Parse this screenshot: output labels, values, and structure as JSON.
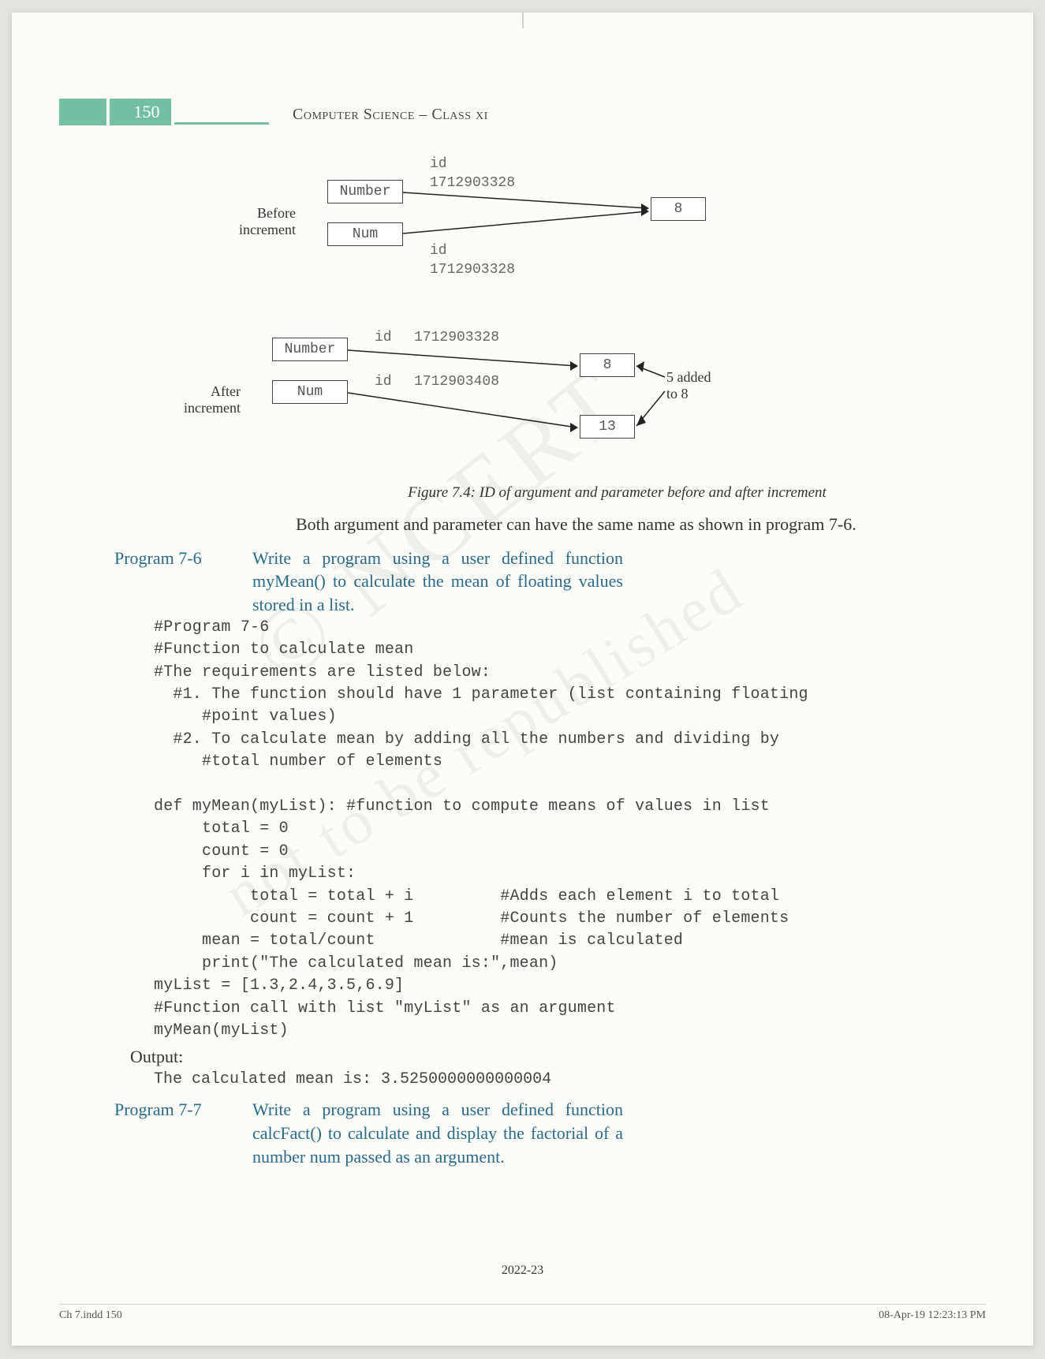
{
  "header": {
    "pageNumber": "150",
    "title": "Computer Science – Class xi"
  },
  "watermarks": {
    "w1": "© NCERT",
    "w2": "not to be republished"
  },
  "diagram": {
    "id_label": "id",
    "before": {
      "label_l1": "Before",
      "label_l2": "increment",
      "box1": "Number",
      "box2": "Num",
      "id1": "1712903328",
      "id2": "1712903328",
      "value": "8"
    },
    "after": {
      "label_l1": "After",
      "label_l2": "increment",
      "box1": "Number",
      "box2": "Num",
      "id1": "1712903328",
      "id2": "1712903408",
      "value1": "8",
      "value2": "13",
      "note_l1": "5 added",
      "note_l2": "to 8"
    }
  },
  "figure": {
    "caption": "Figure 7.4: ID of argument and parameter before and after increment"
  },
  "paragraph": {
    "text": "Both argument and parameter can have the same name as shown in program 7-6."
  },
  "program76": {
    "label": "Program 7-6",
    "desc": "Write a program using a user defined function myMean() to calculate the mean of floating values stored in a list.",
    "code": "#Program 7-6\n#Function to calculate mean\n#The requirements are listed below:\n  #1. The function should have 1 parameter (list containing floating\n     #point values)\n  #2. To calculate mean by adding all the numbers and dividing by\n     #total number of elements\n\ndef myMean(myList): #function to compute means of values in list\n     total = 0\n     count = 0\n     for i in myList:\n          total = total + i         #Adds each element i to total\n          count = count + 1         #Counts the number of elements\n     mean = total/count             #mean is calculated\n     print(\"The calculated mean is:\",mean)\nmyList = [1.3,2.4,3.5,6.9]\n#Function call with list \"myList\" as an argument\nmyMean(myList)",
    "outputLabel": "Output:",
    "outputText": "The calculated mean is: 3.5250000000000004"
  },
  "program77": {
    "label": "Program 7-7",
    "desc": "Write a program using a user defined function calcFact() to calculate and display the factorial of a number num passed as an argument."
  },
  "footer": {
    "year": "2022-23",
    "left": "Ch 7.indd   150",
    "right": "08-Apr-19   12:23:13 PM"
  }
}
